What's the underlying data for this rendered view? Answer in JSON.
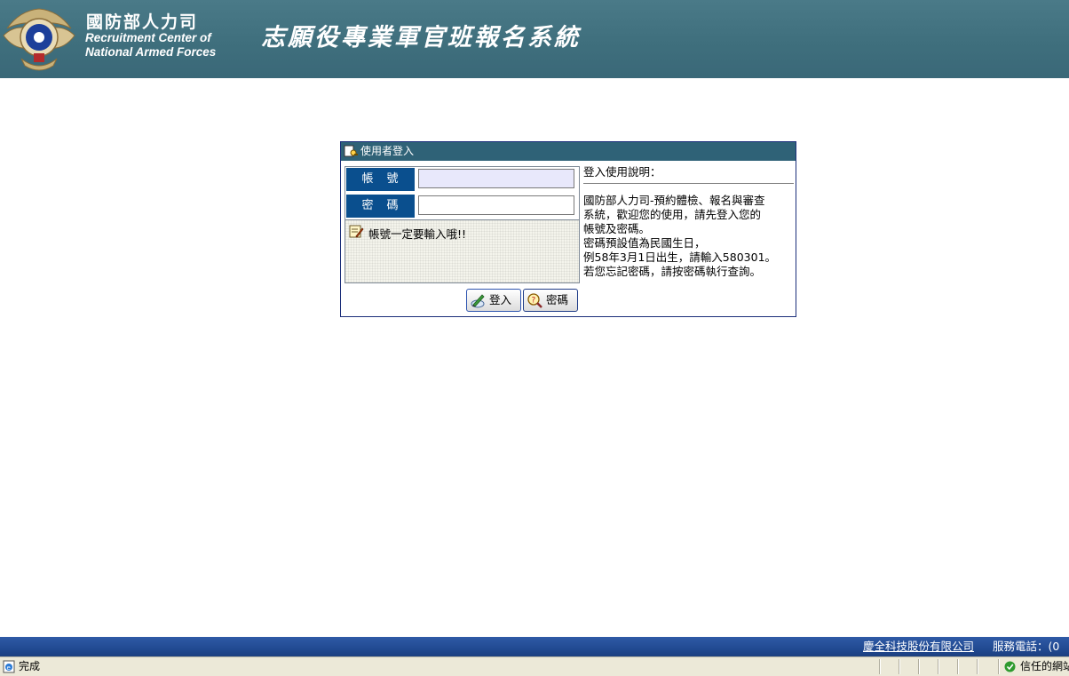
{
  "header": {
    "org_cn": "國防部人力司",
    "org_en_line1": "Recruitment Center of",
    "org_en_line2": "National Armed Forces",
    "system_title": "志願役專業軍官班報名系統"
  },
  "login": {
    "title": "使用者登入",
    "account_label": "帳　號",
    "password_label": "密　碼",
    "account_value": "",
    "password_value": "",
    "message": "帳號一定要輸入哦!!",
    "login_button": "登入",
    "password_button": "密碼"
  },
  "help": {
    "title": "登入使用說明：",
    "lines": [
      "國防部人力司-預約體檢、報名與審查",
      "系統，歡迎您的使用，請先登入您的",
      "帳號及密碼。",
      "密碼預設值為民國生日，",
      "例58年3月1日出生，請輸入580301。",
      "若您忘記密碼，請按密碼執行查詢。"
    ]
  },
  "footer": {
    "company": "慶全科技股份有限公司",
    "phone": "服務電話：(0"
  },
  "statusbar": {
    "text": "完成",
    "zone": "信任的網站"
  },
  "colors": {
    "header_bg": "#3f6f7d",
    "label_bg": "#0a4f8e",
    "titlebar_bg": "#2f6277",
    "footer_bg": "#214a92"
  }
}
